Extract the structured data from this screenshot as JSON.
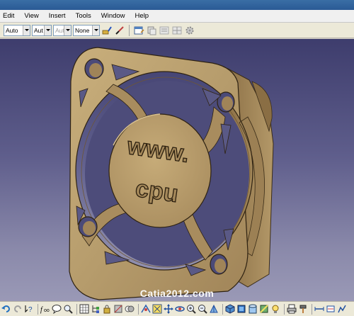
{
  "menu": {
    "items": [
      "Edit",
      "View",
      "Insert",
      "Tools",
      "Window",
      "Help"
    ]
  },
  "style_toolbar": {
    "color_value": "Auto",
    "linetype_value": "Aut",
    "thickness_value": "Aut",
    "layer_value": "None"
  },
  "viewport": {
    "model_text_line1": "www.",
    "model_text_line2": "cpu",
    "watermark": "Catia2012.com",
    "colors": {
      "background_top": "#3e3d6d",
      "background_bottom": "#9a99b6",
      "part_face": "#b69c6c",
      "part_side": "#9c8054"
    }
  },
  "bottom_toolbar": {
    "icons": [
      "undo-icon",
      "redo-icon",
      "help-icon",
      "formula-icon",
      "comment-icon",
      "grid-icon",
      "tree-icon",
      "lock-icon",
      "hide-icon",
      "fly-icon",
      "fit-all-icon",
      "pan-icon",
      "rotate-icon",
      "zoom-in-icon",
      "zoom-out-icon",
      "normal-view-icon",
      "iso-view-icon",
      "shading-icon",
      "render-icon",
      "measure-icon",
      "light-icon",
      "material-icon",
      "swap-icon",
      "analysis-icon"
    ]
  }
}
